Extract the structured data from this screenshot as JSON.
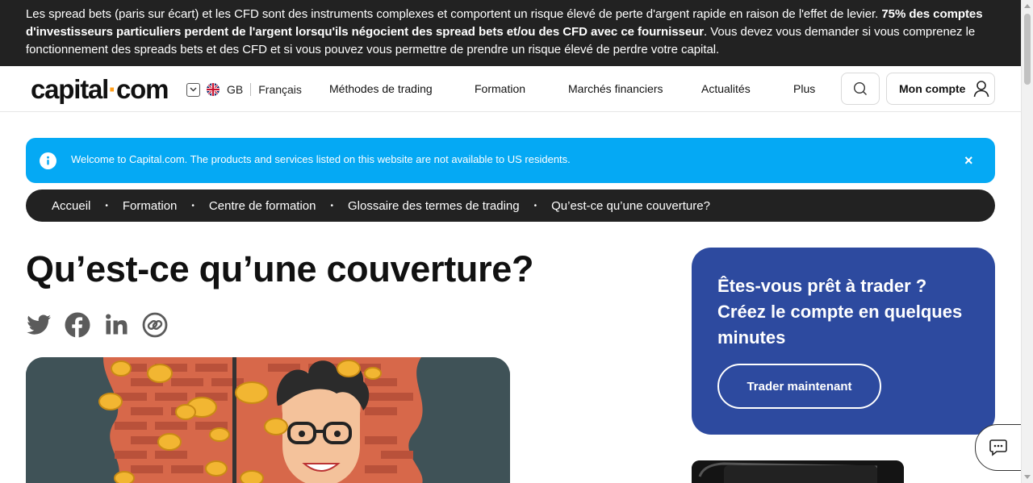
{
  "risk_banner": {
    "text_before": "Les spread bets (paris sur écart) et les CFD sont des instruments complexes et comportent un risque élevé de perte d'argent rapide en raison de l'effet de levier. ",
    "text_bold": "75% des comptes d'investisseurs particuliers perdent de l'argent lorsqu'ils négocient des spread bets et/ou des CFD avec ce fournisseur",
    "text_after": ". Vous devez vous demander si vous comprenez le fonctionnement des spreads bets et des CFD et si vous pouvez vous permettre de prendre un risque élevé de perdre votre capital."
  },
  "header": {
    "logo_left": "capital",
    "logo_dot": "·",
    "logo_right": "com",
    "region": "GB",
    "language": "Français",
    "nav": [
      "Méthodes de trading",
      "Formation",
      "Marchés financiers",
      "Actualités",
      "Plus"
    ],
    "account_label": "Mon compte"
  },
  "alert": {
    "text": "Welcome to Capital.com. The products and services listed on this website are not available to US residents.",
    "close": "×"
  },
  "breadcrumb": [
    "Accueil",
    "Formation",
    "Centre de formation",
    "Glossaire des termes de trading",
    "Qu’est-ce qu’une couverture?"
  ],
  "page": {
    "title": "Qu’est-ce qu’une couverture?"
  },
  "cta": {
    "title": "Êtes-vous prêt à trader ? Créez le compte en quelques minutes",
    "button": "Trader maintenant"
  },
  "colors": {
    "banner_bg": "#222222",
    "alert_bg": "#05a9f4",
    "cta_bg": "#2d4a9f",
    "logo_dot": "#ff9e1b"
  }
}
